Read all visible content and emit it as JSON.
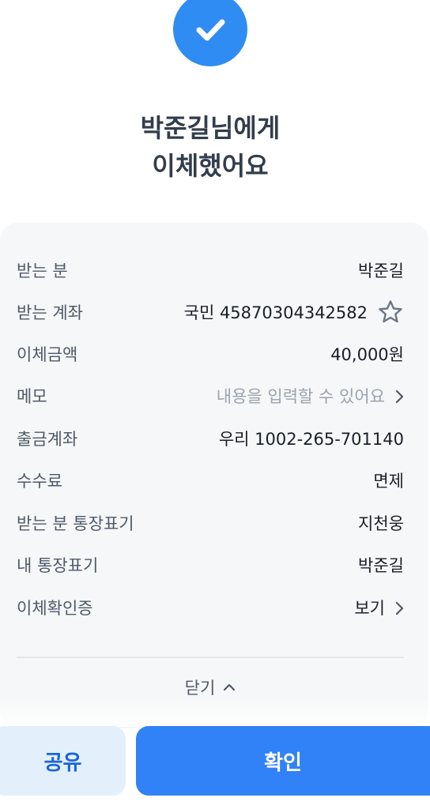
{
  "header": {
    "title_line1": "박준길님에게",
    "title_line2": "이체했어요"
  },
  "details": [
    {
      "label": "받는 분",
      "value": "박준길"
    },
    {
      "label": "받는 계좌",
      "value": "국민 45870304342582",
      "icon": "star-outline-icon"
    },
    {
      "label": "이체금액",
      "value": "40,000원"
    },
    {
      "label": "메모",
      "value": "내용을 입력할 수 있어요",
      "is_placeholder": true,
      "icon": "chevron-right-icon"
    },
    {
      "label": "출금계좌",
      "value": "우리 1002-265-701140"
    },
    {
      "label": "수수료",
      "value": "면제"
    },
    {
      "label": "받는 분 통장표기",
      "value": "지천웅"
    },
    {
      "label": "내 통장표기",
      "value": "박준길"
    },
    {
      "label": "이체확인증",
      "value": "보기",
      "icon": "chevron-right-icon"
    }
  ],
  "close": {
    "label": "닫기",
    "icon": "chevron-up-icon"
  },
  "buttons": {
    "share_label": "공유",
    "confirm_label": "확인"
  },
  "colors": {
    "accent": "#3182f6",
    "share_bg": "#e3f0fc",
    "share_text": "#1b64da",
    "card_bg": "#f6f7f8",
    "title_text": "#333d4b"
  }
}
